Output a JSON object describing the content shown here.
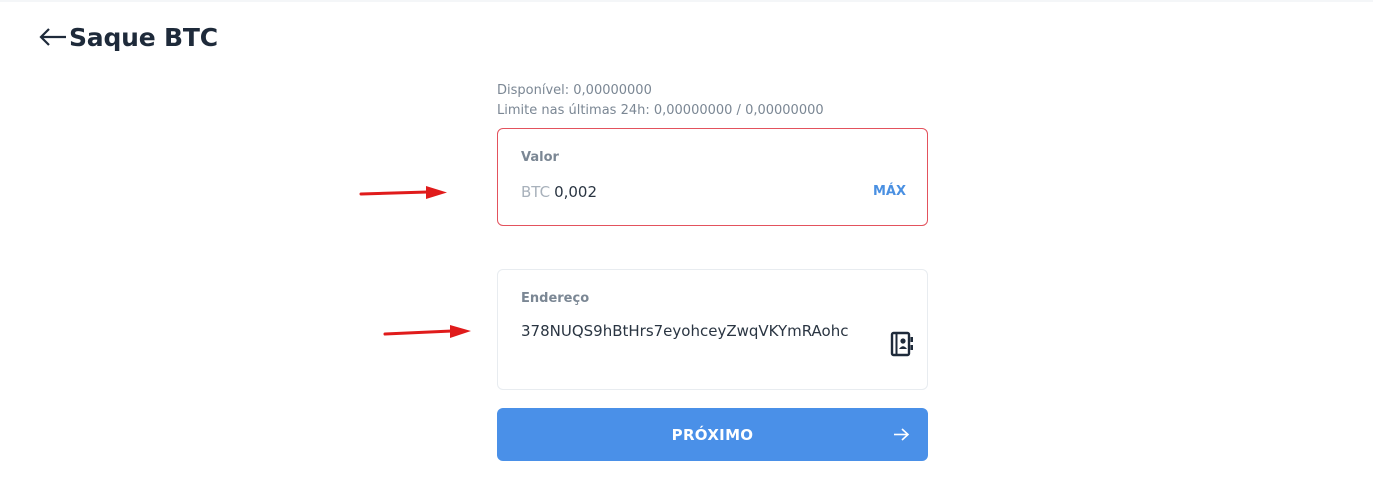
{
  "header": {
    "title": "Saque BTC",
    "back_icon": "arrow-left-icon"
  },
  "info": {
    "available": "Disponível: 0,00000000",
    "limit": "Limite nas últimas 24h: 0,00000000 / 0,00000000"
  },
  "amount_field": {
    "label": "Valor",
    "currency": "BTC",
    "value": "0,002",
    "max_label": "MÁX",
    "border_color": "#e3525d"
  },
  "address_field": {
    "label": "Endereço",
    "value": "378NUQS9hBtHrs7eyohceyZwqVKYmRAohc",
    "icon": "address-book-icon"
  },
  "next_button": {
    "label": "PRÓXIMO",
    "icon": "arrow-right-icon",
    "color": "#4a90e8"
  },
  "annotations": {
    "arrow_color": "#e01b1b"
  }
}
